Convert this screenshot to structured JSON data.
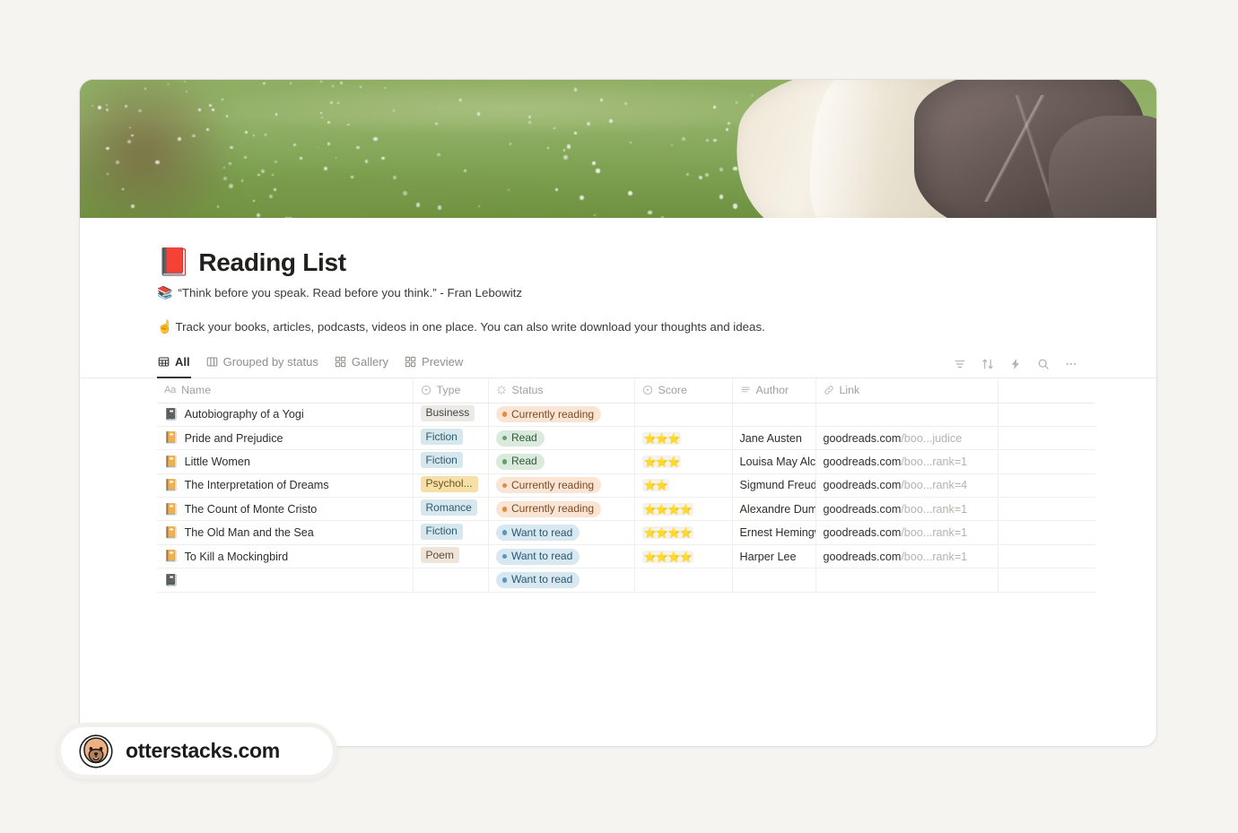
{
  "page": {
    "title": "Reading List",
    "title_emoji": "📕",
    "quote": "“Think before you speak. Read before you think.” - Fran Lebowitz",
    "quote_emoji": "📚",
    "description": "Track your books, articles, podcasts, videos in one place. You can also write download your thoughts and ideas.",
    "description_emoji": "☝️",
    "background_color": "#f5f4f1",
    "card_color": "#ffffff"
  },
  "cover": {
    "alt": "Blurred green meadow with white wildflowers, a cream dress and a dark rock"
  },
  "views": {
    "tabs": [
      {
        "label": "All",
        "icon": "table-icon",
        "active": true
      },
      {
        "label": "Grouped by status",
        "icon": "board-icon",
        "active": false
      },
      {
        "label": "Gallery",
        "icon": "gallery-icon",
        "active": false
      },
      {
        "label": "Preview",
        "icon": "gallery-icon",
        "active": false
      }
    ],
    "toolbar": [
      {
        "name": "filter-icon",
        "title": "Filter"
      },
      {
        "name": "sort-icon",
        "title": "Sort"
      },
      {
        "name": "automation-icon",
        "title": "Automations"
      },
      {
        "name": "search-icon",
        "title": "Search"
      },
      {
        "name": "more-options-icon",
        "title": "More"
      }
    ]
  },
  "table": {
    "columns": [
      {
        "key": "name",
        "label": "Name",
        "icon": "text-title-icon"
      },
      {
        "key": "type",
        "label": "Type",
        "icon": "select-icon"
      },
      {
        "key": "status",
        "label": "Status",
        "icon": "status-spinner-icon"
      },
      {
        "key": "score",
        "label": "Score",
        "icon": "select-icon"
      },
      {
        "key": "author",
        "label": "Author",
        "icon": "text-lines-icon"
      },
      {
        "key": "link",
        "label": "Link",
        "icon": "link-icon"
      }
    ],
    "rows": [
      {
        "icon": "📓",
        "name": "Autobiography of a Yogi",
        "type": "Business",
        "type_color": "gray",
        "status": "Currently reading",
        "status_color": "orange",
        "score": "",
        "stars": 0,
        "author": "",
        "link_domain": "",
        "link_path": ""
      },
      {
        "icon": "📔",
        "name": "Pride and Prejudice",
        "type": "Fiction",
        "type_color": "blue",
        "status": "Read",
        "status_color": "green",
        "score": "⭐⭐⭐",
        "stars": 3,
        "author": "Jane Austen",
        "link_domain": "goodreads.com",
        "link_path": "/boo...judice"
      },
      {
        "icon": "📔",
        "name": "Little Women",
        "type": "Fiction",
        "type_color": "blue",
        "status": "Read",
        "status_color": "green",
        "score": "⭐⭐⭐",
        "stars": 3,
        "author": "Louisa May Alcott",
        "link_domain": "goodreads.com",
        "link_path": "/boo...rank=1"
      },
      {
        "icon": "📔",
        "name": "The Interpretation of Dreams",
        "type": "Psychol...",
        "type_color": "yellow",
        "status": "Currently reading",
        "status_color": "orange",
        "score": "⭐⭐",
        "stars": 2,
        "author": "Sigmund Freud",
        "link_domain": "goodreads.com",
        "link_path": "/boo...rank=4"
      },
      {
        "icon": "📔",
        "name": "The Count of Monte Cristo",
        "type": "Romance",
        "type_color": "blue",
        "status": "Currently reading",
        "status_color": "orange",
        "score": "⭐⭐⭐⭐",
        "stars": 4,
        "author": "Alexandre Dumas",
        "link_domain": "goodreads.com",
        "link_path": "/boo...rank=1"
      },
      {
        "icon": "📔",
        "name": "The Old Man and the Sea",
        "type": "Fiction",
        "type_color": "blue",
        "status": "Want to read",
        "status_color": "blue",
        "score": "⭐⭐⭐⭐",
        "stars": 4,
        "author": "Ernest Hemingway",
        "link_domain": "goodreads.com",
        "link_path": "/boo...rank=1"
      },
      {
        "icon": "📔",
        "name": "To Kill a Mockingbird",
        "type": "Poem",
        "type_color": "beige",
        "status": "Want to read",
        "status_color": "blue",
        "score": "⭐⭐⭐⭐",
        "stars": 4,
        "author": "Harper Lee",
        "link_domain": "goodreads.com",
        "link_path": "/boo...rank=1"
      },
      {
        "icon": "📓",
        "name": "",
        "type": "",
        "type_color": "none",
        "status": "Want to read",
        "status_color": "blue",
        "score": "",
        "stars": 0,
        "author": "",
        "link_domain": "",
        "link_path": ""
      }
    ]
  },
  "watermark": {
    "label": "otterstacks.com",
    "logo": "otter-face-icon"
  }
}
